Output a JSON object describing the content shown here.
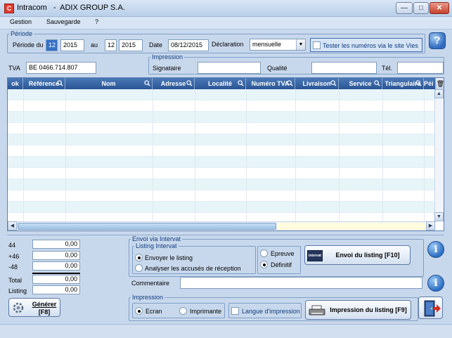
{
  "window": {
    "app_icon": "C",
    "title": "Intracom   -  ADIX GROUP S.A.",
    "min": "—",
    "max": "□",
    "close": "✕"
  },
  "menu": [
    "Gestion",
    "Sauvegarde",
    "?"
  ],
  "periode": {
    "group_label": "Période",
    "periode_du_label": "Période du",
    "from_month": "12",
    "from_year": "2015",
    "au_label": "au",
    "to_month": "12",
    "to_year": "2015",
    "date_label": "Date",
    "date_value": "08/12/2015",
    "declaration_label": "Déclaration",
    "declaration_value": "mensuelle",
    "tester_label": "Tester les numéros via le site Vies"
  },
  "help_icon": "?",
  "tva": {
    "label": "TVA",
    "value": "BE 0466.714.807"
  },
  "impression_top": {
    "group_label": "Impression",
    "signataire_label": "Signataire",
    "signataire_value": "",
    "qualite_label": "Qualité",
    "qualite_value": "",
    "tel_label": "Tél.",
    "tel_value": ""
  },
  "grid": {
    "columns": [
      "ok",
      "Référence",
      "Nom",
      "Adresse",
      "Localité",
      "Numéro TVA",
      "Livraison",
      "Service",
      "Triangulaire",
      "Péi"
    ],
    "row_count": 12
  },
  "totals": [
    {
      "label": "44",
      "value": "0,00"
    },
    {
      "label": "+46",
      "value": "0,00"
    },
    {
      "label": "-48",
      "value": "0,00"
    },
    {
      "label": "Total",
      "value": "0,00"
    },
    {
      "label": "Listing",
      "value": "0,00"
    }
  ],
  "generer": {
    "label": "Générer",
    "shortcut": "[F8]"
  },
  "intervat": {
    "group_label": "Envoi via Intervat",
    "listing_group_label": "Listing Intervat",
    "envoyer_label": "Envoyer le listing",
    "analyser_label": "Analyser les accusés de réception",
    "epreuve_label": "Epreuve",
    "definitif_label": "Définitif",
    "envoi_icon_text": "intervat",
    "envoi_button": "Envoi du listing  [F10]",
    "commentaire_label": "Commentaire",
    "commentaire_value": ""
  },
  "impression_bottom": {
    "group_label": "Impression",
    "ecran_label": "Ecran",
    "imprimante_label": "Imprimante",
    "langue_label": "Langue d'impression",
    "print_button": "Impression du listing  [F9]"
  },
  "info_icon": "i"
}
